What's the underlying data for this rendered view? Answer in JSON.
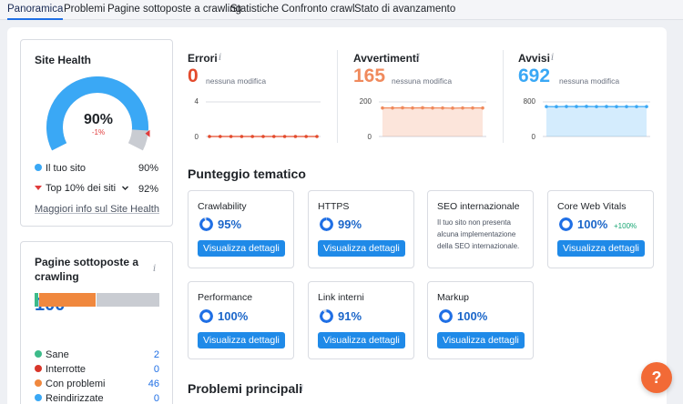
{
  "tabs": [
    {
      "label": "Panoramica",
      "active": true
    },
    {
      "label": "Problemi"
    },
    {
      "label": "Pagine sottoposte a crawling"
    },
    {
      "label": "Statistiche"
    },
    {
      "label": "Confronto crawl"
    },
    {
      "label": "Stato di avanzamento"
    }
  ],
  "site_health": {
    "title": "Site Health",
    "score": "90%",
    "score_fraction": 0.9,
    "change": "-1%",
    "your_site_label": "Il tuo sito",
    "your_site_value": "90%",
    "top10_label": "Top 10% dei siti",
    "top10_value": "92%",
    "more_link": "Maggiori info sul Site Health",
    "colors": {
      "gauge": "#3aa8f5",
      "track": "#c9ccd2",
      "marker": "#e03b3b"
    }
  },
  "metrics": [
    {
      "label": "Errori",
      "value": "0",
      "sub": "nessuna modifica",
      "color": "#e34a2c",
      "y_ticks": [
        "4",
        "0"
      ],
      "chart_data": {
        "type": "line",
        "values": [
          0,
          0,
          0,
          0,
          0,
          0,
          0,
          0,
          0,
          0,
          0
        ],
        "ylim": [
          0,
          4
        ]
      }
    },
    {
      "label": "Avvertimenti",
      "value": "165",
      "sub": "nessuna modifica",
      "color": "#f08a5d",
      "y_ticks": [
        "200",
        "0"
      ],
      "chart_data": {
        "type": "area",
        "values": [
          165,
          165,
          166,
          165,
          166,
          165,
          165,
          164,
          165,
          165,
          165
        ],
        "ylim": [
          0,
          200
        ]
      }
    },
    {
      "label": "Avvisi",
      "value": "692",
      "sub": "nessuna modifica",
      "color": "#3aa8f5",
      "y_ticks": [
        "800",
        "0"
      ],
      "chart_data": {
        "type": "area",
        "values": [
          692,
          690,
          694,
          693,
          696,
          692,
          693,
          691,
          692,
          692,
          692
        ],
        "ylim": [
          0,
          800
        ]
      }
    }
  ],
  "thematic": {
    "title": "Punteggio tematico",
    "cards": [
      {
        "title": "Crawlability",
        "pct": "95%",
        "frac": 0.95,
        "button": "Visualizza dettagli"
      },
      {
        "title": "HTTPS",
        "pct": "99%",
        "frac": 0.99,
        "button": "Visualizza dettagli"
      },
      {
        "title": "SEO internazionale",
        "desc": "Il tuo sito non presenta alcuna implementazione della SEO internazionale."
      },
      {
        "title": "Core Web Vitals",
        "pct": "100%",
        "frac": 1.0,
        "delta": "+100%",
        "button": "Visualizza dettagli"
      },
      {
        "title": "Performance",
        "pct": "100%",
        "frac": 1.0,
        "button": "Visualizza dettagli"
      },
      {
        "title": "Link interni",
        "pct": "91%",
        "frac": 0.91,
        "button": "Visualizza dettagli"
      },
      {
        "title": "Markup",
        "pct": "100%",
        "frac": 1.0,
        "button": "Visualizza dettagli"
      }
    ]
  },
  "crawled": {
    "title": "Pagine sottoposte a crawling",
    "total": "100",
    "rows": [
      {
        "label": "Sane",
        "value": "2",
        "color": "#3dbb8a"
      },
      {
        "label": "Interrotte",
        "value": "0",
        "color": "#d8362a"
      },
      {
        "label": "Con problemi",
        "value": "46",
        "color": "#f0883e"
      },
      {
        "label": "Reindirizzate",
        "value": "0",
        "color": "#3aa8f5"
      }
    ],
    "bar_colors": {
      "healthy": "#3dbb8a",
      "issues": "#f0883e",
      "other": "#c9ccd2"
    }
  },
  "problems": {
    "title": "Problemi principali"
  },
  "help": {
    "label": "?"
  },
  "icons": {
    "info": "info-icon",
    "chevron": "chevron-down-icon",
    "triangle": "triangle-down-icon"
  }
}
